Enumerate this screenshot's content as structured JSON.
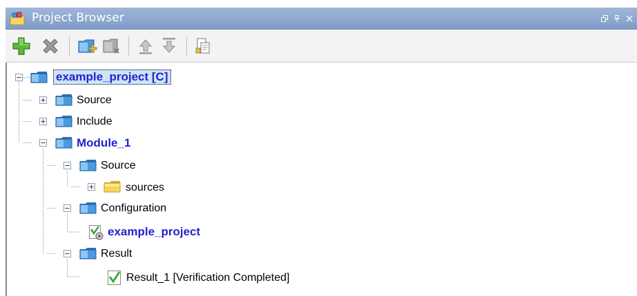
{
  "panel": {
    "title": "Project Browser",
    "window_buttons": [
      "restore",
      "pin",
      "close"
    ]
  },
  "toolbar": {
    "buttons": [
      {
        "name": "new-project",
        "icon": "green-plus-icon"
      },
      {
        "name": "remove",
        "icon": "gray-x-icon"
      },
      {
        "name": "add-module",
        "icon": "folder-add-icon"
      },
      {
        "name": "remove-module",
        "icon": "folder-remove-icon"
      },
      {
        "name": "move-up",
        "icon": "arrow-up-icon"
      },
      {
        "name": "move-down",
        "icon": "arrow-down-icon"
      },
      {
        "name": "copy",
        "icon": "copy-icon"
      }
    ]
  },
  "tree": {
    "root": "example_project [C]",
    "source": "Source",
    "include": "Include",
    "module": "Module_1",
    "module_source": "Source",
    "sources": "sources",
    "configuration": "Configuration",
    "config_item": "example_project",
    "result": "Result",
    "result_item": "Result_1 [Verification Completed]"
  },
  "colors": {
    "titlebar": "#8fa9d2",
    "selected_text": "#2323cf",
    "selection_bg": "#cde3f8",
    "folder_blue": "#3f8fd6",
    "folder_yellow": "#f7d55a",
    "check_green": "#3aa534"
  }
}
